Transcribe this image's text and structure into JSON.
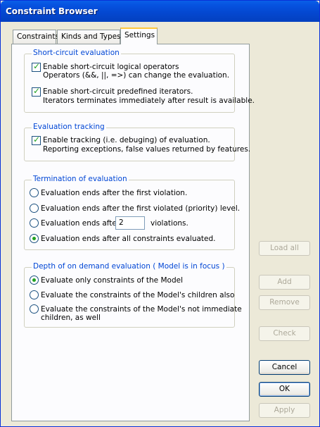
{
  "window": {
    "title": "Constraint Browser"
  },
  "tabs": [
    {
      "label": "Constraints"
    },
    {
      "label": "Kinds and Types"
    },
    {
      "label": "Settings"
    }
  ],
  "groups": {
    "short_circuit": {
      "legend": "Short-circuit evaluation",
      "logical": {
        "line1": "Enable short-circuit logical operators",
        "line2": "Operators (&&, ||, =>) can change the evaluation.",
        "checked": true
      },
      "iterators": {
        "line1": "Enable short-circuit predefined iterators.",
        "line2": "Iterators terminates immediately after result is available.",
        "checked": true
      }
    },
    "tracking": {
      "legend": "Evaluation tracking",
      "option": {
        "line1": "Enable tracking (i.e. debuging) of evaluation.",
        "line2": "Reporting exceptions, false values returned by features.",
        "checked": true
      }
    },
    "termination": {
      "legend": "Termination of evaluation",
      "opt1": "Evaluation ends after the first violation.",
      "opt2": "Evaluation ends after the first violated (priority) level.",
      "opt3_prefix": "Evaluation ends after",
      "opt3_value": "2",
      "opt3_suffix": "violations.",
      "opt4": "Evaluation ends after all constraints evaluated.",
      "selected": 4
    },
    "depth": {
      "legend": "Depth of on demand evaluation ( Model is in focus )",
      "opt1": "Evaluate only constraints of the Model",
      "opt2": "Evaluate the constraints of the Model's children also",
      "opt3_line1": "Evaluate the constraints of the Model's not immediate",
      "opt3_line2": "children, as well",
      "selected": 1
    }
  },
  "buttons": {
    "load_all": "Load all",
    "add": "Add",
    "remove": "Remove",
    "check": "Check",
    "cancel": "Cancel",
    "ok": "OK",
    "apply": "Apply"
  },
  "colors": {
    "titlebar": "#0453d8",
    "legend": "#0046d5",
    "check": "#21a121"
  }
}
